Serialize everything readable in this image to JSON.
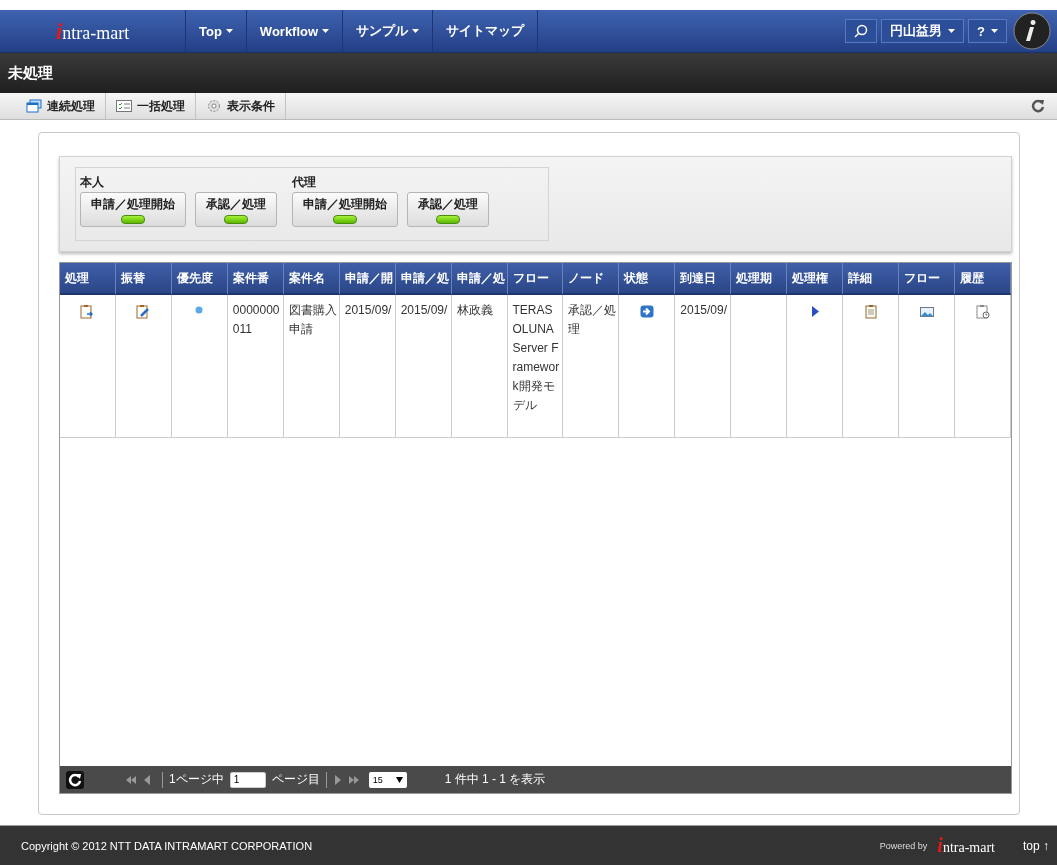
{
  "nav": {
    "logo": "ntra-mart",
    "logo_initial": "i",
    "menus": [
      {
        "label": "Top",
        "dropdown": true
      },
      {
        "label": "Workflow",
        "dropdown": true
      },
      {
        "label": "サンプル",
        "dropdown": true
      },
      {
        "label": "サイトマップ",
        "dropdown": false
      }
    ],
    "user": "円山益男",
    "help": "?"
  },
  "page_title": "未処理",
  "toolbar": [
    {
      "label": "連続処理"
    },
    {
      "label": "一括処理"
    },
    {
      "label": "表示条件"
    }
  ],
  "filters": [
    {
      "label": "本人",
      "buttons": [
        {
          "label": "申請／処理開始",
          "on": true
        },
        {
          "label": "承認／処理",
          "on": true
        }
      ]
    },
    {
      "label": "代理",
      "buttons": [
        {
          "label": "申請／処理開始",
          "on": true
        },
        {
          "label": "承認／処理",
          "on": true
        }
      ]
    }
  ],
  "table": {
    "columns": [
      "処理",
      "振替",
      "優先度",
      "案件番",
      "案件名",
      "申請／開",
      "申請／処",
      "申請／処",
      "フロー",
      "ノード",
      "状態",
      "到達日",
      "処理期",
      "処理権",
      "詳細",
      "フロー",
      "履歴"
    ],
    "rows": [
      [
        {
          "kind": "icon"
        },
        {
          "kind": "icon"
        },
        {
          "kind": "icon"
        },
        {
          "kind": "text",
          "text": "0000000011"
        },
        {
          "kind": "text",
          "text": "図書購入申請"
        },
        {
          "kind": "text",
          "text": "2015/09/"
        },
        {
          "kind": "text",
          "text": "2015/09/"
        },
        {
          "kind": "text",
          "text": "林政義"
        },
        {
          "kind": "text",
          "text": "TERASOLUNA Server Framework開発モデル"
        },
        {
          "kind": "text",
          "text": "承認／処理"
        },
        {
          "kind": "icon"
        },
        {
          "kind": "text",
          "text": "2015/09/"
        },
        {
          "kind": "empty"
        },
        {
          "kind": "icon"
        },
        {
          "kind": "icon"
        },
        {
          "kind": "icon"
        },
        {
          "kind": "icon"
        }
      ]
    ]
  },
  "pager": {
    "before": "1ページ中",
    "page": "1",
    "after": "ページ目",
    "per_page": "15",
    "summary": "1 件中 1 - 1 を表示"
  },
  "footer": {
    "copyright": "Copyright © 2012 NTT DATA INTRAMART CORPORATION",
    "powered_by": "Powered by",
    "logo": "ntra-mart",
    "logo_initial": "i",
    "top_link": "top ↑"
  }
}
